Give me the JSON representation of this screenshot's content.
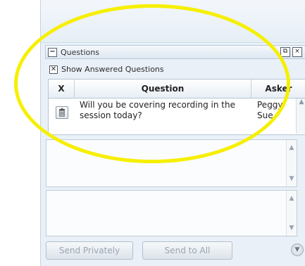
{
  "questions_panel": {
    "title": "Questions",
    "collapse_glyph": "−",
    "header_buttons": [
      "⧉",
      "×"
    ],
    "show_answered": {
      "label": "Show Answered Questions",
      "checked": true,
      "glyph": "✕"
    },
    "table": {
      "columns": [
        "X",
        "Question",
        "Asker"
      ],
      "rows": [
        {
          "question": "Will you be covering recording in the session today?",
          "asker": "Peggy Sue"
        }
      ]
    }
  },
  "scroll_up_glyph": "▲",
  "scroll_down_glyph": "▼",
  "actions": {
    "send_privately": "Send Privately",
    "send_to_all": "Send to All",
    "round_glyph": "▼"
  },
  "annotation_color": "#f6ef00"
}
